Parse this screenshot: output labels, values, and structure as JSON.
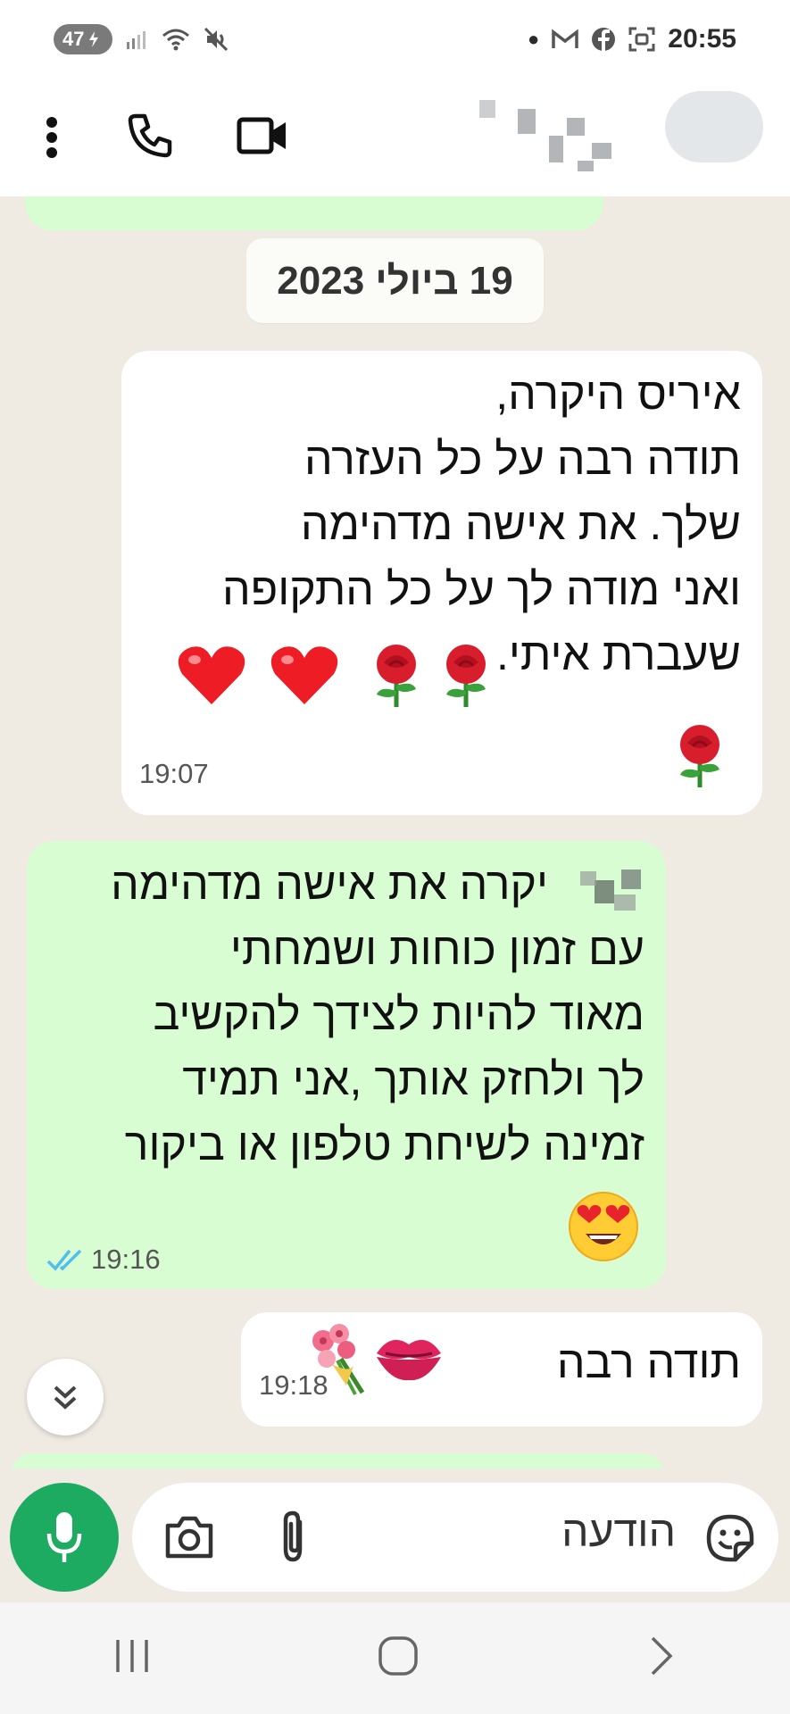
{
  "status_bar": {
    "battery": "47",
    "time": "20:55"
  },
  "chat": {
    "date_chip": "19 ביולי 2023",
    "messages": [
      {
        "direction": "incoming",
        "text": "איריס היקרה,\nתודה רבה על כל העזרה\nשלך. את אישה מדהימה\nואני מודה לך על כל התקופה\nשעברת איתי.",
        "time": "19:07"
      },
      {
        "direction": "outgoing",
        "text": "יקרה את אישה מדהימה\nעם  זמון כוחות ושמחתי\nמאוד להיות לצידך להקשיב\nלך ולחזק אותך ,אני תמיד\nזמינה לשיחת טלפון או ביקור",
        "time": "19:16",
        "status": "read"
      },
      {
        "direction": "incoming",
        "text": "תודה רבה",
        "time": "19:18"
      }
    ]
  },
  "input": {
    "placeholder": "הודעה"
  },
  "colors": {
    "chat_bg": "#efeae2",
    "outgoing_bubble": "#d9fdd3",
    "incoming_bubble": "#ffffff",
    "mic_button": "#1daa61",
    "read_ticks": "#53bdeb"
  }
}
